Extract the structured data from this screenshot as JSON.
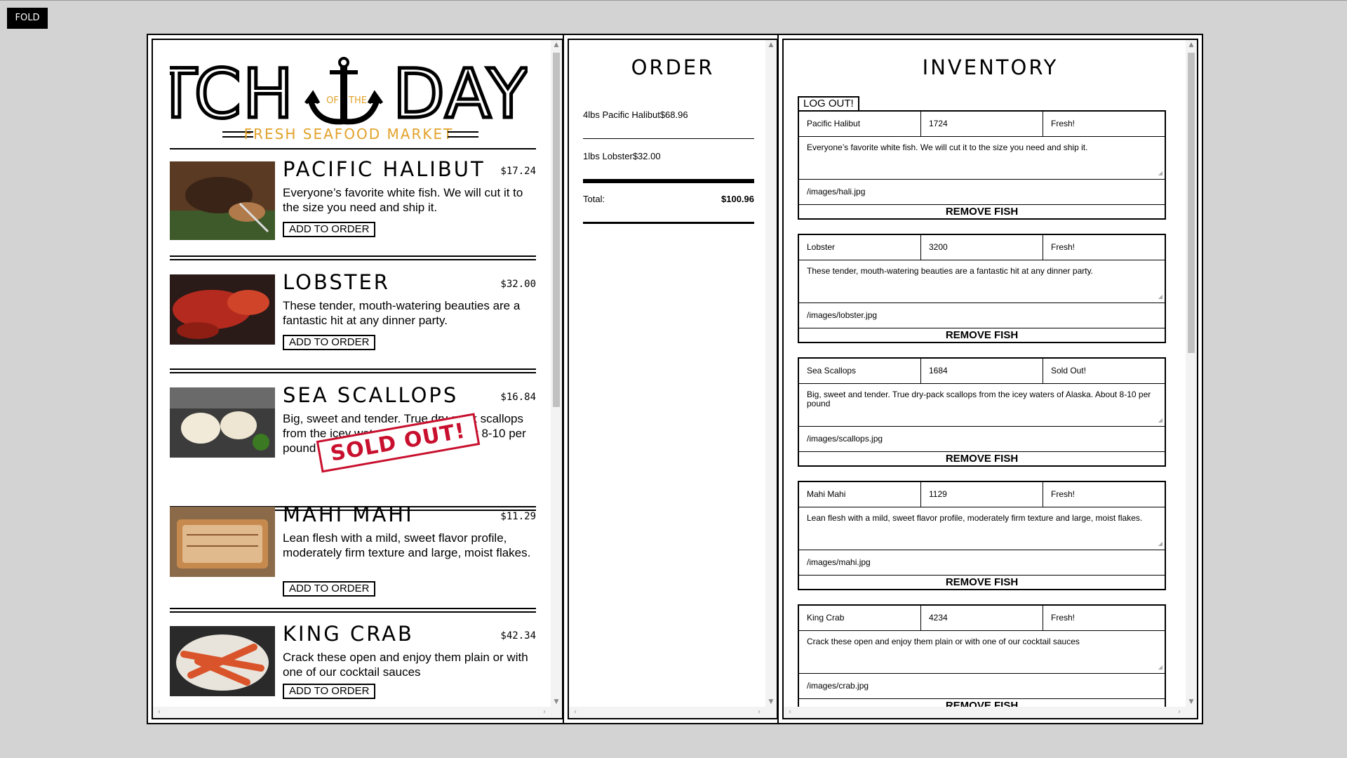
{
  "fold_button": "FOLD",
  "menu": {
    "logo": {
      "word_left": "CATCH",
      "word_right": "DAY",
      "of": "OF",
      "the": "THE",
      "subtitle": "FRESH SEAFOOD MARKET"
    },
    "fish": [
      {
        "name": "PACIFIC HALIBUT",
        "price": "$17.24",
        "desc": "Everyone’s favorite white fish. We will cut it to the size you need and ship it.",
        "button": "ADD TO ORDER",
        "image_icon": "halibut-photo"
      },
      {
        "name": "LOBSTER",
        "price": "$32.00",
        "desc": "These tender, mouth-watering beauties are a fantastic hit at any dinner party.",
        "button": "ADD TO ORDER",
        "image_icon": "lobster-photo"
      },
      {
        "name": "SEA SCALLOPS",
        "price": "$16.84",
        "desc": "Big, sweet and tender. True dry-pack scallops from the icey waters of Alaska. About 8-10 per pound",
        "stamp": "SOLD OUT!",
        "image_icon": "scallops-photo"
      },
      {
        "name": "MAHI MAHI",
        "price": "$11.29",
        "desc": "Lean flesh with a mild, sweet flavor profile, moderately firm texture and large, moist flakes.",
        "button": "ADD TO ORDER",
        "image_icon": "mahi-photo"
      },
      {
        "name": "KING CRAB",
        "price": "$42.34",
        "desc": "Crack these open and enjoy them plain or with one of our cocktail sauces",
        "button": "ADD TO ORDER",
        "image_icon": "crab-photo"
      }
    ]
  },
  "order": {
    "title": "ORDER",
    "lines": [
      "4lbs Pacific Halibut$68.96",
      "1lbs Lobster$32.00"
    ],
    "total_label": "Total:",
    "total_value": "$100.96"
  },
  "inventory": {
    "title": "INVENTORY",
    "logout": "LOG OUT!",
    "items": [
      {
        "name": "Pacific Halibut",
        "price": "1724",
        "status": "Fresh!",
        "desc": "Everyone’s favorite white fish. We will cut it to the size you need and ship it.",
        "image": "/images/hali.jpg",
        "remove": "REMOVE FISH"
      },
      {
        "name": "Lobster",
        "price": "3200",
        "status": "Fresh!",
        "desc": "These tender, mouth-watering beauties are a fantastic hit at any dinner party.",
        "image": "/images/lobster.jpg",
        "remove": "REMOVE FISH"
      },
      {
        "name": "Sea Scallops",
        "price": "1684",
        "status": "Sold Out!",
        "desc": "Big, sweet and tender. True dry-pack scallops from the icey waters of Alaska. About 8-10 per pound",
        "image": "/images/scallops.jpg",
        "remove": "REMOVE FISH"
      },
      {
        "name": "Mahi Mahi",
        "price": "1129",
        "status": "Fresh!",
        "desc": "Lean flesh with a mild, sweet flavor profile, moderately firm texture and large, moist flakes.",
        "image": "/images/mahi.jpg",
        "remove": "REMOVE FISH"
      },
      {
        "name": "King Crab",
        "price": "4234",
        "status": "Fresh!",
        "desc": "Crack these open and enjoy them plain or with one of our cocktail sauces",
        "image": "/images/crab.jpg",
        "remove": "REMOVE FISH"
      }
    ]
  },
  "colors": {
    "accent": "#e2a22b",
    "sold_out": "#c8102e",
    "background": "#d3d3d3"
  }
}
